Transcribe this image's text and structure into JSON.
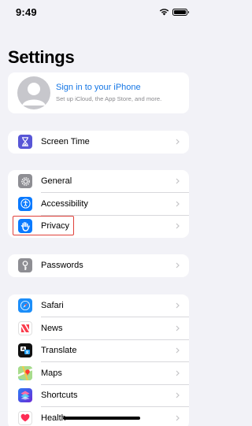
{
  "status_bar": {
    "time": "9:49"
  },
  "header": {
    "title": "Settings"
  },
  "profile": {
    "title": "Sign in to your iPhone",
    "subtitle": "Set up iCloud, the App Store, and more."
  },
  "groups": {
    "screen_time": [
      {
        "label": "Screen Time",
        "icon": "hourglass-icon",
        "color": "#5856d6"
      }
    ],
    "general": [
      {
        "label": "General",
        "icon": "gear-icon",
        "color": "#8e8e93"
      },
      {
        "label": "Accessibility",
        "icon": "accessibility-icon",
        "color": "#0a7aff"
      },
      {
        "label": "Privacy",
        "icon": "hand-icon",
        "color": "#0a7aff"
      }
    ],
    "passwords": [
      {
        "label": "Passwords",
        "icon": "key-icon",
        "color": "#8e8e93"
      }
    ],
    "apps": [
      {
        "label": "Safari",
        "icon": "compass-icon",
        "color": "#1c8ef9"
      },
      {
        "label": "News",
        "icon": "news-icon",
        "color": "#ffffff"
      },
      {
        "label": "Translate",
        "icon": "translate-icon",
        "color": "#111111"
      },
      {
        "label": "Maps",
        "icon": "map-icon",
        "color": "#5ac46a"
      },
      {
        "label": "Shortcuts",
        "icon": "shortcuts-icon",
        "color": "#3b3ccf"
      },
      {
        "label": "Health",
        "icon": "heart-icon",
        "color": "#ffffff"
      }
    ]
  },
  "highlight": {
    "target": "Privacy",
    "color": "#e0403a"
  },
  "colors": {
    "background": "#f2f2f7",
    "accent": "#1677e5"
  }
}
